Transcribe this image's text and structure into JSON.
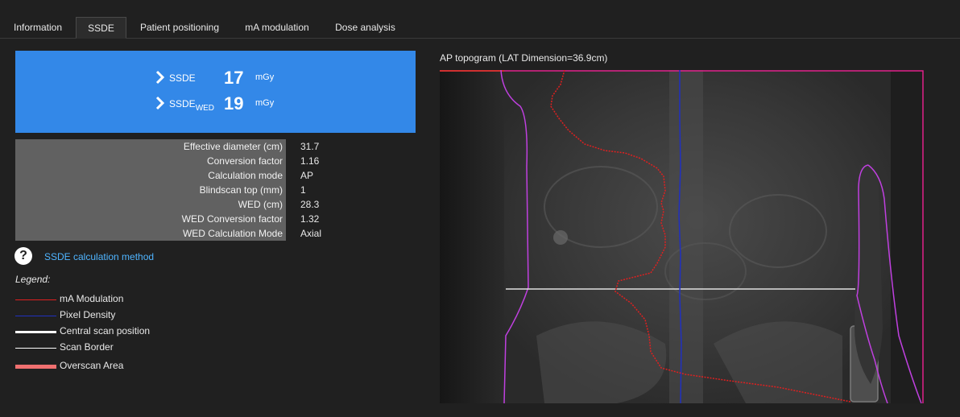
{
  "tabs": [
    "Information",
    "SSDE",
    "Patient positioning",
    "mA modulation",
    "Dose analysis"
  ],
  "active_tab": "SSDE",
  "ssde": {
    "ssde_label": "SSDE",
    "ssde_value": "17",
    "ssde_unit": "mGy",
    "wed_label": "SSDE",
    "wed_sub": "WED",
    "wed_value": "19",
    "wed_unit": "mGy"
  },
  "info": [
    {
      "key": "Effective diameter (cm)",
      "value": "31.7"
    },
    {
      "key": "Conversion factor",
      "value": "1.16"
    },
    {
      "key": "Calculation mode",
      "value": "AP"
    },
    {
      "key": "Blindscan top (mm)",
      "value": "1"
    },
    {
      "key": "WED (cm)",
      "value": "28.3"
    },
    {
      "key": "WED Conversion factor",
      "value": "1.32"
    },
    {
      "key": "WED Calculation Mode",
      "value": "Axial"
    }
  ],
  "help": {
    "icon": "question-icon",
    "glyph": "?",
    "link_text": "SSDE calculation method"
  },
  "legend": {
    "title": "Legend:",
    "items": [
      {
        "label": "mA Modulation",
        "color": "#e02020"
      },
      {
        "label": "Pixel Density",
        "color": "#2030c0"
      },
      {
        "label": "Central scan position",
        "color": "#ffffff"
      },
      {
        "label": "Scan Border",
        "color": "#ffffff"
      },
      {
        "label": "Overscan Area",
        "color": "#f07070"
      }
    ]
  },
  "topogram": {
    "title": "AP topogram (LAT Dimension=36.9cm)",
    "colors": {
      "ma_modulation": "#e02020",
      "pixel_density": "#2030c0",
      "central_scan": "#e0e0e0",
      "body_contour": "#c040e0",
      "scan_border": "#e0208a",
      "overscan": "#d03030"
    }
  },
  "colors": {
    "accent": "#3388e8",
    "link": "#4fb4ff",
    "background": "#202020",
    "table_key_bg": "#616161"
  }
}
